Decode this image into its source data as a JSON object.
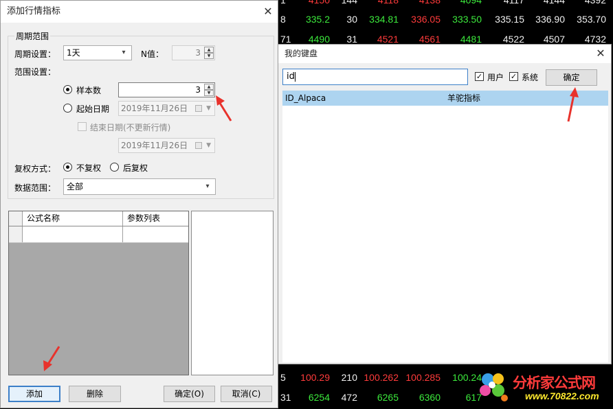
{
  "quotes": {
    "rows": [
      [
        {
          "text": "4150",
          "color": "red"
        },
        {
          "text": "144",
          "color": "white"
        },
        {
          "text": "4118",
          "color": "red"
        },
        {
          "text": "4138",
          "color": "red"
        },
        {
          "text": "4094",
          "color": "green"
        },
        {
          "text": "4117",
          "color": "white"
        },
        {
          "text": "4144",
          "color": "white"
        },
        {
          "text": "4392",
          "color": "white"
        }
      ],
      [
        {
          "text": "335.2",
          "color": "green"
        },
        {
          "text": "30",
          "color": "white"
        },
        {
          "text": "334.81",
          "color": "green"
        },
        {
          "text": "336.05",
          "color": "red"
        },
        {
          "text": "333.50",
          "color": "green"
        },
        {
          "text": "335.15",
          "color": "white"
        },
        {
          "text": "336.90",
          "color": "white"
        },
        {
          "text": "353.70",
          "color": "white"
        }
      ],
      [
        {
          "text": "4490",
          "color": "green"
        },
        {
          "text": "31",
          "color": "white"
        },
        {
          "text": "4521",
          "color": "red"
        },
        {
          "text": "4561",
          "color": "red"
        },
        {
          "text": "4481",
          "color": "green"
        },
        {
          "text": "4522",
          "color": "white"
        },
        {
          "text": "4507",
          "color": "white"
        },
        {
          "text": "4732",
          "color": "white"
        }
      ],
      [
        {
          "text": "100.29",
          "color": "red"
        },
        {
          "text": "210",
          "color": "white"
        },
        {
          "text": "100.262",
          "color": "red"
        },
        {
          "text": "100.285",
          "color": "red"
        },
        {
          "text": "100.24",
          "color": "green"
        },
        {
          "text": "",
          "color": "white"
        },
        {
          "text": "",
          "color": "white"
        },
        {
          "text": "",
          "color": "white"
        }
      ],
      [
        {
          "text": "6254",
          "color": "green"
        },
        {
          "text": "472",
          "color": "white"
        },
        {
          "text": "6265",
          "color": "green"
        },
        {
          "text": "6360",
          "color": "green"
        },
        {
          "text": "617",
          "color": "green"
        },
        {
          "text": "",
          "color": "white"
        },
        {
          "text": "",
          "color": "white"
        },
        {
          "text": "",
          "color": "white"
        }
      ]
    ],
    "left_fragments": [
      "1",
      "8",
      "71",
      "5",
      "31"
    ]
  },
  "colors": {
    "up": "#ff3b3b",
    "down": "#3ce93c",
    "neutral": "#f0f0f0",
    "accent": "#3c7fc8",
    "selection": "#add4f0",
    "annotation_arrow": "#e8322c"
  },
  "add_dialog": {
    "title": "添加行情指标",
    "close_icon": "close-icon",
    "period_group_label": "周期范围",
    "period_setting_label": "周期设置：",
    "period_value": "1天",
    "n_label": "N值：",
    "n_value": "3",
    "range_setting_label": "范围设置：",
    "sample_count_label": "样本数",
    "sample_count_value": "3",
    "start_date_label": "起始日期",
    "start_date_value": "2019年11月26日",
    "end_date_label": "结束日期(不更新行情)",
    "end_date_value": "2019年11月26日",
    "adjust_label": "复权方式：",
    "no_adjust_label": "不复权",
    "back_adjust_label": "后复权",
    "data_range_label": "数据范围：",
    "data_range_value": "全部",
    "columns": [
      "公式名称",
      "参数列表"
    ],
    "buttons": {
      "add": "添加",
      "delete": "删除",
      "ok": "确定(O)",
      "cancel": "取消(C)"
    }
  },
  "keyboard_dialog": {
    "title": "我的键盘",
    "close_icon": "close-icon",
    "search_value": "id",
    "user_label": "用户",
    "user_checked": true,
    "system_label": "系统",
    "system_checked": true,
    "ok_label": "确定",
    "results": [
      {
        "code": "ID_Alpaca",
        "name": "羊驼指标"
      }
    ]
  },
  "logo": {
    "text": "分析家公式网",
    "url": "www.70822.com"
  }
}
